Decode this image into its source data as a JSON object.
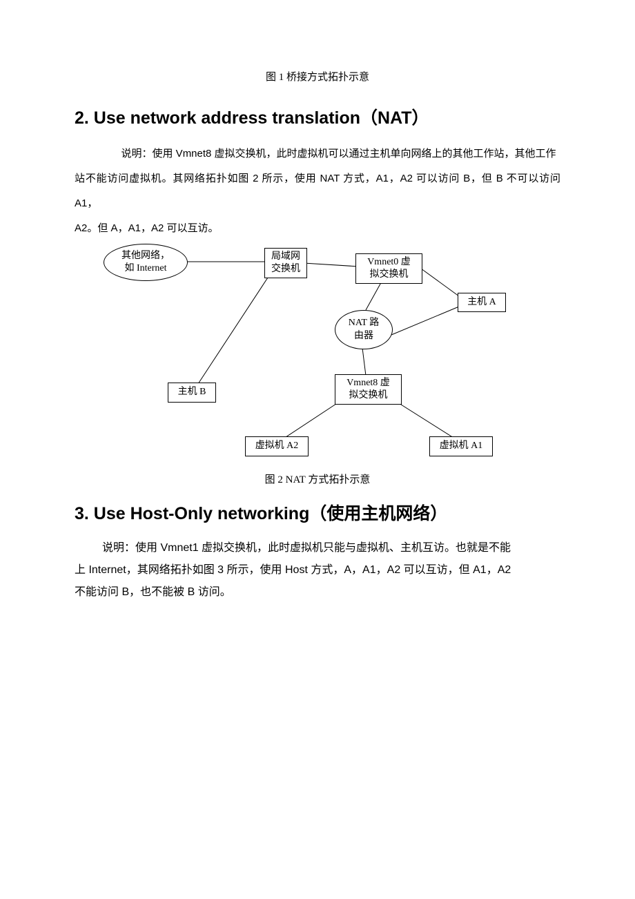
{
  "caption_figure1": "图 1 桥接方式拓扑示意",
  "section2": {
    "heading_num": "2. ",
    "heading_en": "Use network address translation",
    "heading_brackets": "（NAT）",
    "para_t1": "说明：使用",
    "para_t2": " Vmnet8 ",
    "para_t3": "虚拟交换机，此时虚拟机可以通过主机单向网络上的其他工作站，其他工作",
    "para_line2a": "站不能访问虚拟机。其网络拓扑如图",
    "para_line2b": " 2 ",
    "para_line2c": "所示，使用",
    "para_line2d": " NAT ",
    "para_line2e": "方式，",
    "para_line2f": "A1",
    "para_line2g": "，",
    "para_line2h": "A2 ",
    "para_line2i": "可以访问",
    "para_line2j": " B",
    "para_line2k": "，但",
    "para_line2l": " B ",
    "para_line2m": "不可以访问",
    "para_line2n": " A1",
    "para_line2o": "，",
    "para_line3a": "A2",
    "para_line3b": "。但",
    "para_line3c": " A",
    "para_line3d": "，",
    "para_line3e": "A1",
    "para_line3f": "，",
    "para_line3g": "A2 ",
    "para_line3h": "可以互访。"
  },
  "diagram2": {
    "other_net_l1": "其他网络，",
    "other_net_l2": "如 Internet",
    "lan_switch_l1": "局域网",
    "lan_switch_l2": "交换机",
    "vmnet0_l1": "Vmnet0 虚",
    "vmnet0_l2": "拟交换机",
    "host_a": "主机 A",
    "nat_router_l1": "NAT 路",
    "nat_router_l2": "由器",
    "vmnet8_l1": "Vmnet8 虚",
    "vmnet8_l2": "拟交换机",
    "host_b": "主机 B",
    "vm_a2": "虚拟机 A2",
    "vm_a1": "虚拟机 A1"
  },
  "caption_figure2": "图 2 NAT 方式拓扑示意",
  "section3": {
    "heading_num": "3. ",
    "heading_en": "Use Host-Only networking",
    "heading_cjk": "（使用主机网络）",
    "p_a": "说明：使用",
    "p_b": " Vmnet1 ",
    "p_c": "虚拟交换机，此时虚拟机只能与虚拟机、主机互访。也就是不能",
    "p2_a": "上",
    "p2_b": " Internet",
    "p2_c": "，其网络拓扑如图",
    "p2_d": " 3 ",
    "p2_e": "所示，使用",
    "p2_f": " Host ",
    "p2_g": "方式，",
    "p2_h": "A",
    "p2_i": "，",
    "p2_j": "A1",
    "p2_k": "，",
    "p2_l": "A2 ",
    "p2_m": "可以互访，但",
    "p2_n": " A1",
    "p2_o": "，",
    "p2_p": "A2",
    "p3_a": "不能访问",
    "p3_b": " B",
    "p3_c": "，也不能被",
    "p3_d": " B ",
    "p3_e": "访问。"
  }
}
